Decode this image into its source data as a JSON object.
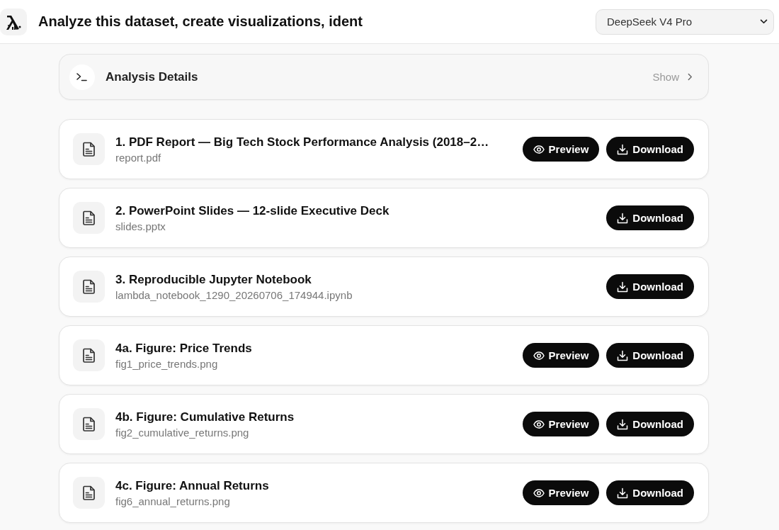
{
  "header": {
    "title": "Analyze this dataset, create visualizations, ident",
    "model_select": {
      "value": "DeepSeek V4 Pro"
    }
  },
  "details_panel": {
    "title": "Analysis Details",
    "action": "Show",
    "expanded": false
  },
  "files": [
    {
      "title": "1. PDF Report — Big Tech Stock Performance Analysis (2018–2…",
      "filename": "report.pdf",
      "actions": [
        {
          "kind": "preview",
          "label": "Preview"
        },
        {
          "kind": "download",
          "label": "Download"
        }
      ]
    },
    {
      "title": "2. PowerPoint Slides — 12-slide Executive Deck",
      "filename": "slides.pptx",
      "actions": [
        {
          "kind": "download",
          "label": "Download"
        }
      ]
    },
    {
      "title": "3. Reproducible Jupyter Notebook",
      "filename": "lambda_notebook_1290_20260706_174944.ipynb",
      "actions": [
        {
          "kind": "download",
          "label": "Download"
        }
      ]
    },
    {
      "title": "4a. Figure: Price Trends",
      "filename": "fig1_price_trends.png",
      "actions": [
        {
          "kind": "preview",
          "label": "Preview"
        },
        {
          "kind": "download",
          "label": "Download"
        }
      ]
    },
    {
      "title": "4b. Figure: Cumulative Returns",
      "filename": "fig2_cumulative_returns.png",
      "actions": [
        {
          "kind": "preview",
          "label": "Preview"
        },
        {
          "kind": "download",
          "label": "Download"
        }
      ]
    },
    {
      "title": "4c. Figure: Annual Returns",
      "filename": "fig6_annual_returns.png",
      "actions": [
        {
          "kind": "preview",
          "label": "Preview"
        },
        {
          "kind": "download",
          "label": "Download"
        }
      ]
    }
  ]
}
